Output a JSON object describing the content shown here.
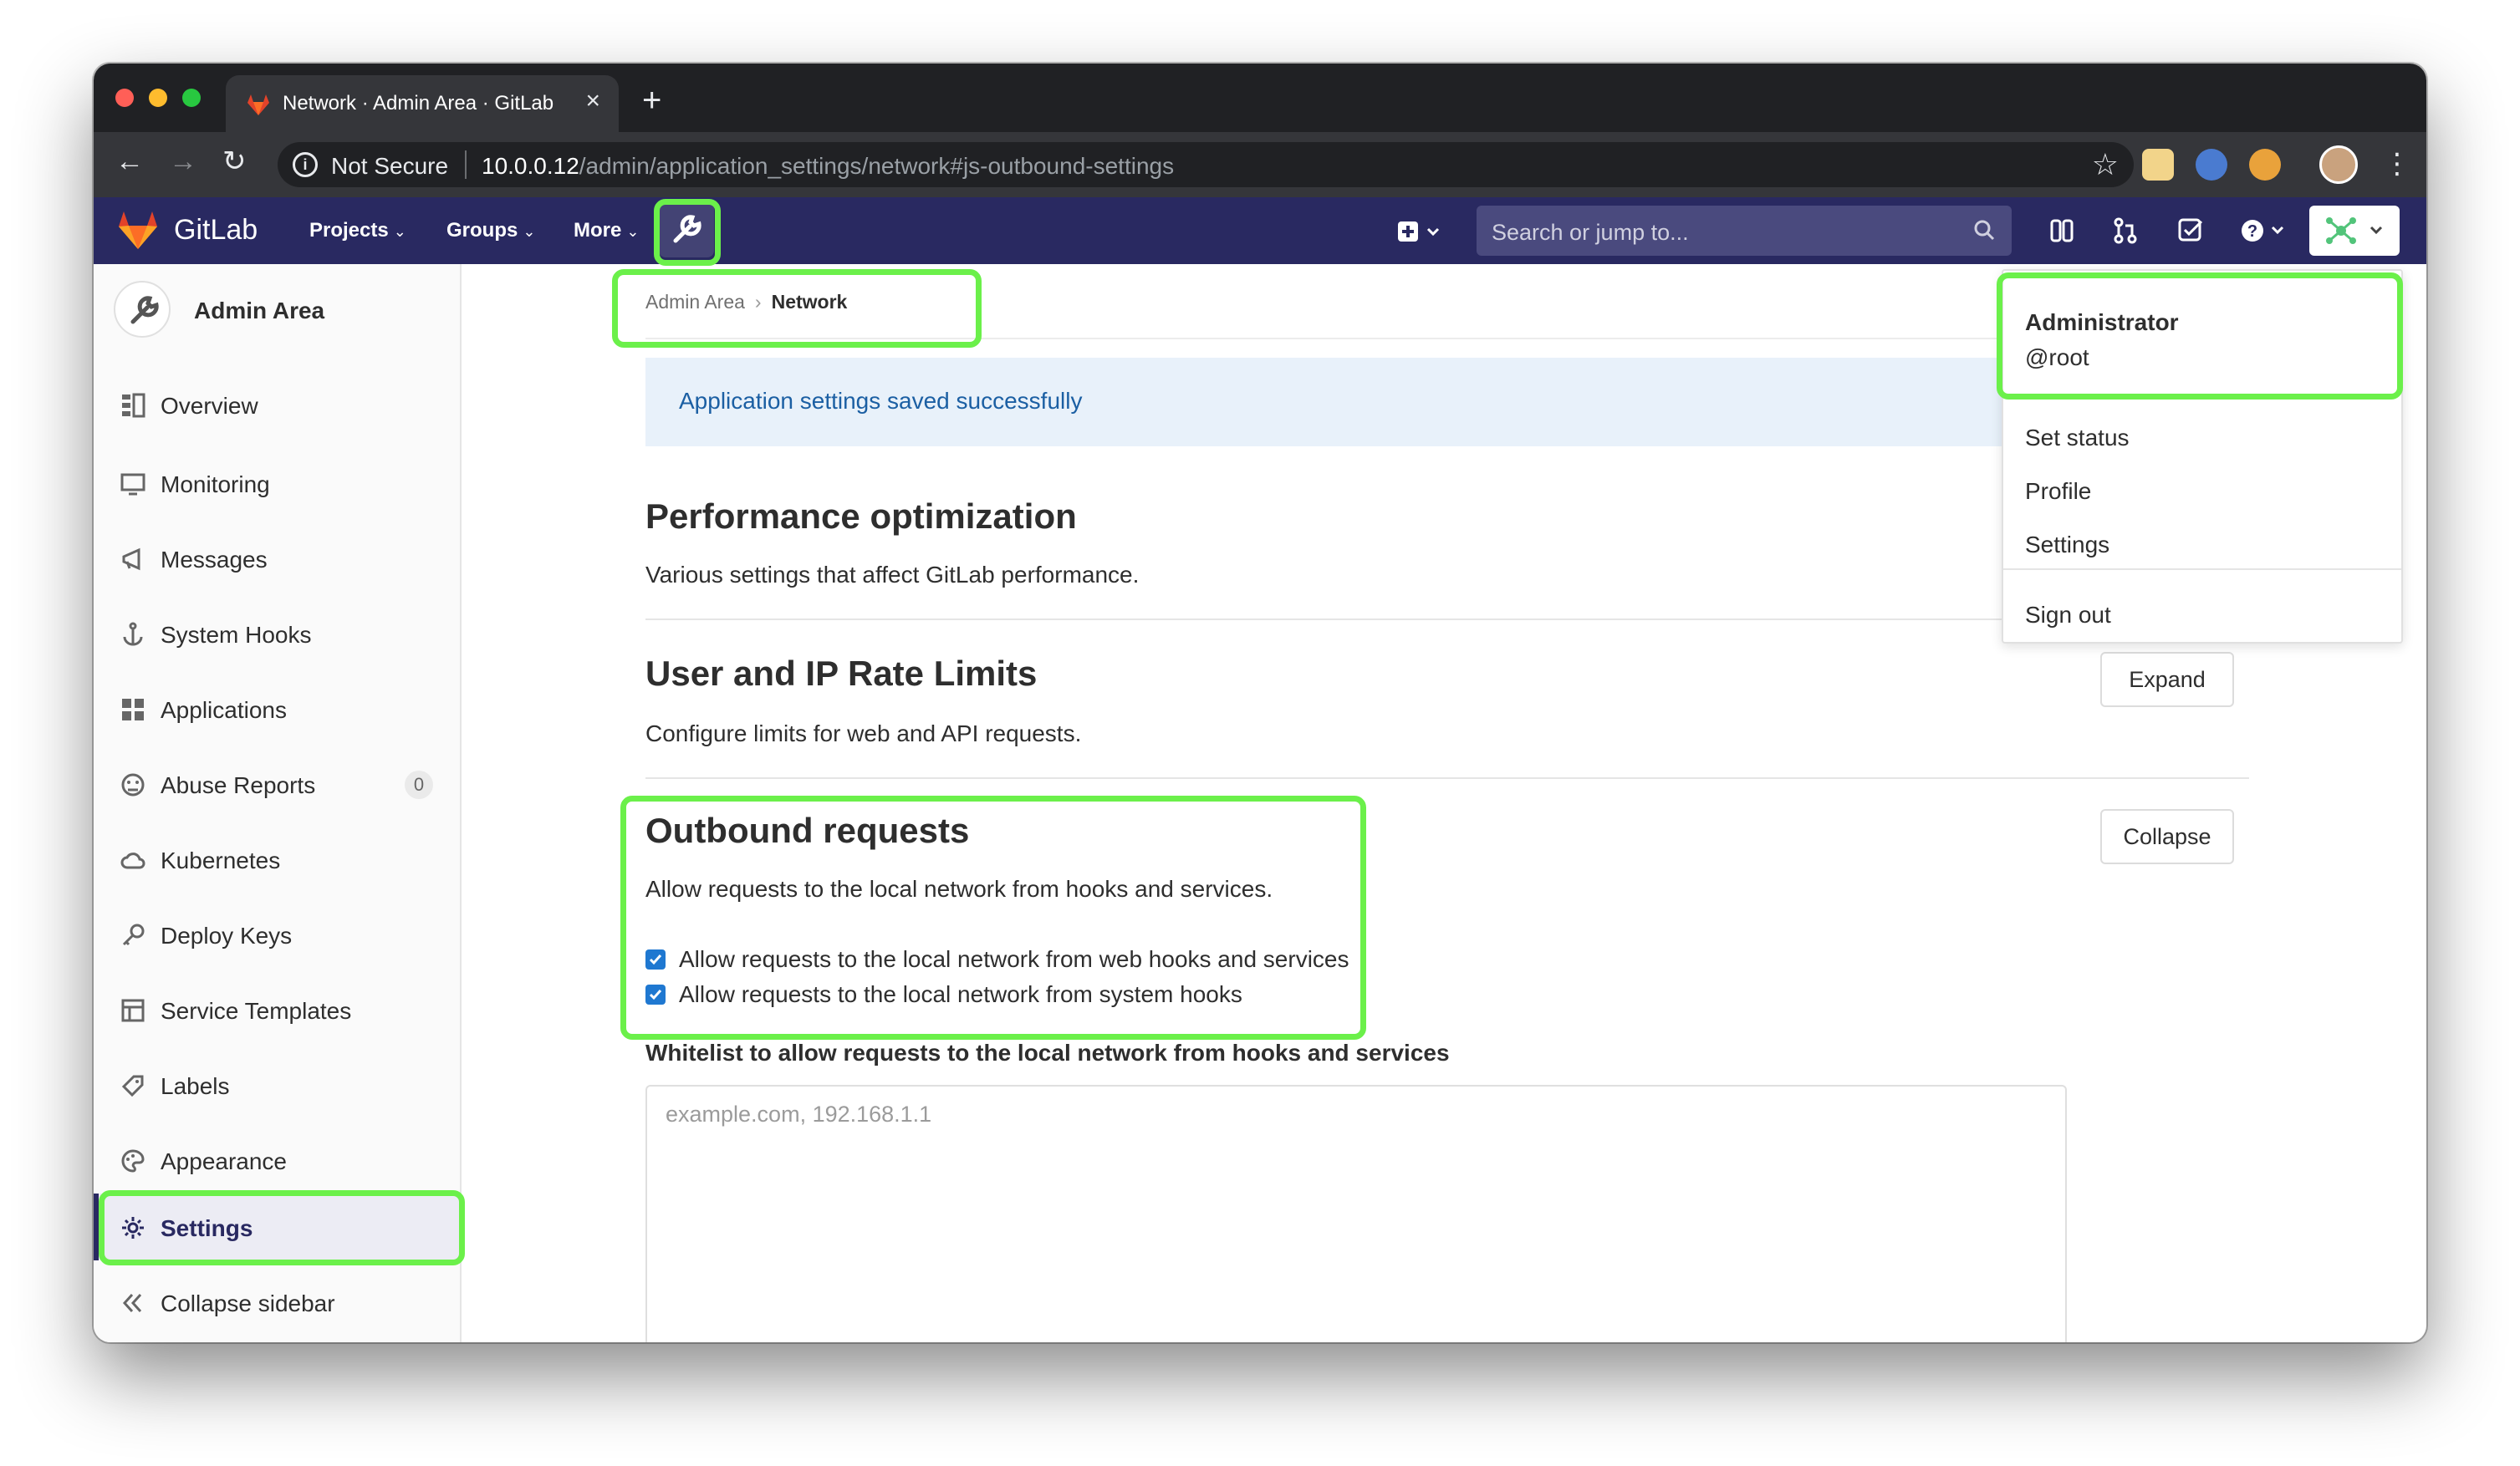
{
  "browser": {
    "tab_title": "Network · Admin Area · GitLab",
    "security_label": "Not Secure",
    "url_host": "10.0.0.12",
    "url_path": "/admin/application_settings/network#js-outbound-settings"
  },
  "navbar": {
    "brand": "GitLab",
    "menus": [
      "Projects",
      "Groups",
      "More"
    ],
    "search_placeholder": "Search or jump to..."
  },
  "sidebar": {
    "title": "Admin Area",
    "items": [
      {
        "label": "Overview",
        "icon": "overview-icon"
      },
      {
        "label": "Monitoring",
        "icon": "monitor-icon"
      },
      {
        "label": "Messages",
        "icon": "megaphone-icon"
      },
      {
        "label": "System Hooks",
        "icon": "anchor-icon"
      },
      {
        "label": "Applications",
        "icon": "grid-icon"
      },
      {
        "label": "Abuse Reports",
        "icon": "abuse-icon",
        "badge": "0"
      },
      {
        "label": "Kubernetes",
        "icon": "cloud-icon"
      },
      {
        "label": "Deploy Keys",
        "icon": "key-icon"
      },
      {
        "label": "Service Templates",
        "icon": "template-icon"
      },
      {
        "label": "Labels",
        "icon": "label-icon"
      },
      {
        "label": "Appearance",
        "icon": "palette-icon"
      },
      {
        "label": "Settings",
        "icon": "gear-icon",
        "active": true
      },
      {
        "label": "Collapse sidebar",
        "icon": "collapse-icon"
      }
    ]
  },
  "breadcrumb": {
    "parent": "Admin Area",
    "current": "Network"
  },
  "flash": "Application settings saved successfully",
  "sections": [
    {
      "title": "Performance optimization",
      "description": "Various settings that affect GitLab performance."
    },
    {
      "title": "User and IP Rate Limits",
      "description": "Configure limits for web and API requests.",
      "button": "Expand"
    },
    {
      "title": "Outbound requests",
      "description": "Allow requests to the local network from hooks and services.",
      "button": "Collapse"
    }
  ],
  "outbound": {
    "checkboxes": [
      {
        "label": "Allow requests to the local network from web hooks and services",
        "checked": true
      },
      {
        "label": "Allow requests to the local network from system hooks",
        "checked": true
      }
    ],
    "whitelist_label": "Whitelist to allow requests to the local network from hooks and services",
    "whitelist_placeholder": "example.com, 192.168.1.1",
    "whitelist_value": ""
  },
  "user_menu": {
    "name": "Administrator",
    "username": "@root",
    "items": [
      "Set status",
      "Profile",
      "Settings"
    ],
    "sign_out": "Sign out"
  },
  "colors": {
    "highlight": "#6bf04a",
    "navbar": "#292961",
    "checkbox": "#1f78d1",
    "flash_text": "#1b5fa3"
  }
}
